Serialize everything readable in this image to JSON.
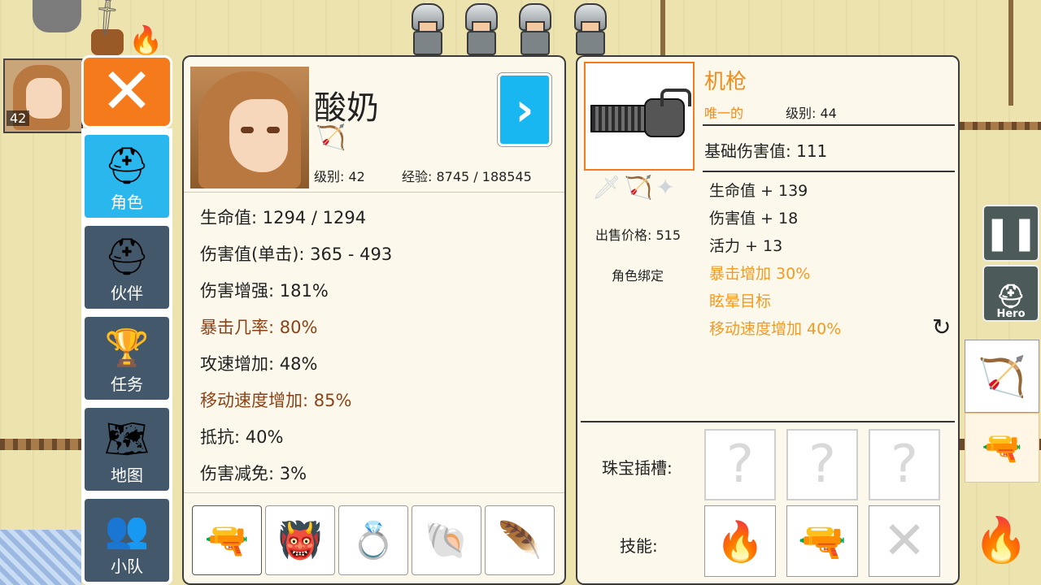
{
  "sidebar": {
    "close_icon": "close-x-icon",
    "items": [
      {
        "label": "角色",
        "icon": "knight-helmet-icon",
        "glyph": "⛑",
        "active": true
      },
      {
        "label": "伙伴",
        "icon": "horned-helmet-icon",
        "glyph": "⛑",
        "active": false
      },
      {
        "label": "任务",
        "icon": "trophy-icon",
        "glyph": "🏆",
        "active": false
      },
      {
        "label": "地图",
        "icon": "map-scroll-icon",
        "glyph": "🗺",
        "active": false
      },
      {
        "label": "小队",
        "icon": "party-icon",
        "glyph": "👥",
        "active": false
      }
    ]
  },
  "character": {
    "name": "酸奶",
    "level": "级别: 42",
    "exp": "经验: 8745 / 188545",
    "weapon_icon": "bow-icon",
    "next_icon": "chevron-right-icon",
    "stats": [
      {
        "text": "生命值: 1294 / 1294",
        "highlight": false
      },
      {
        "text": "伤害值(单击): 365 - 493",
        "highlight": false
      },
      {
        "text": "伤害增强: 181%",
        "highlight": false
      },
      {
        "text": "暴击几率: 80%",
        "highlight": true
      },
      {
        "text": "攻速增加: 48%",
        "highlight": false
      },
      {
        "text": "移动速度增加: 85%",
        "highlight": true
      },
      {
        "text": "抵抗: 40%",
        "highlight": false
      },
      {
        "text": "伤害减免: 3%",
        "highlight": false
      }
    ],
    "equipment": [
      {
        "icon": "minigun-icon",
        "glyph": "🔫"
      },
      {
        "icon": "demon-armor-icon",
        "glyph": "👹"
      },
      {
        "icon": "ruby-ring-icon",
        "glyph": "💍"
      },
      {
        "icon": "shell-amulet-icon",
        "glyph": "🐚"
      },
      {
        "icon": "feather-charm-icon",
        "glyph": "🪶"
      }
    ]
  },
  "item": {
    "name": "机枪",
    "rarity": "唯一的",
    "level": "级别: 44",
    "base_damage": "基础伤害值: 111",
    "sell_price": "出售价格: 515",
    "bind": "角色绑定",
    "type_icons": [
      "sword-icon",
      "bow-icon",
      "staff-icon"
    ],
    "stats": [
      {
        "text": "生命值 + 139",
        "color": "#222222"
      },
      {
        "text": "伤害值 + 18",
        "color": "#222222"
      },
      {
        "text": "活力 + 13",
        "color": "#222222"
      },
      {
        "text": "暴击增加 30%",
        "color": "#f29a22"
      },
      {
        "text": "眩晕目标",
        "color": "#f29a22"
      },
      {
        "text": "移动速度增加 40%",
        "color": "#f29a22"
      }
    ],
    "gem_label": "珠宝插槽:",
    "gem_slots": [
      "?",
      "?",
      "?"
    ],
    "skill_label": "技能:",
    "skills": [
      {
        "icon": "fire-arrow-icon",
        "glyph": "🔥"
      },
      {
        "icon": "minigun-skill-icon",
        "glyph": "🔫"
      },
      {
        "icon": "locked-skill-icon",
        "glyph": "✕"
      }
    ]
  },
  "hud": {
    "pause_icon": "pause-icon",
    "hero_label": "Hero",
    "portrait_level": "42"
  },
  "colors": {
    "accent_orange": "#f47a1c",
    "active_blue": "#29b7ee",
    "highlight_brown": "#8a4218",
    "item_orange": "#f29a22"
  }
}
